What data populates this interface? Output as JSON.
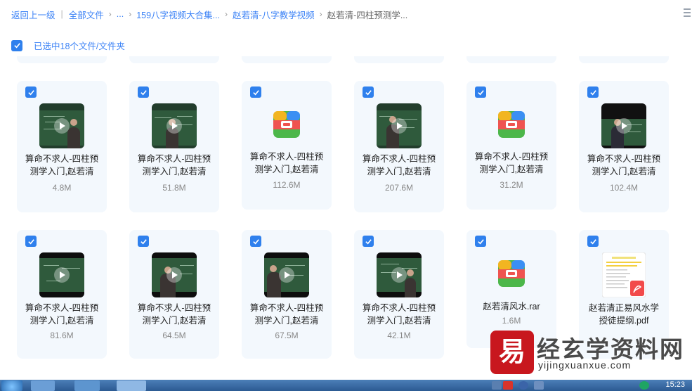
{
  "breadcrumb": {
    "back": "返回上一级",
    "all_files": "全部文件",
    "ellipsis": "...",
    "item1": "159八字视频大合集...",
    "item2": "赵若清-八字教学视频",
    "current": "赵若清-四柱预测学..."
  },
  "selection": {
    "text": "已选中18个文件/文件夹"
  },
  "files": [
    {
      "name_line1": "算命不求人-四柱预",
      "name_line2": "测学入门,赵若清",
      "size": "4.8M",
      "type": "video"
    },
    {
      "name_line1": "算命不求人-四柱预",
      "name_line2": "测学入门,赵若清",
      "size": "51.8M",
      "type": "video"
    },
    {
      "name_line1": "算命不求人-四柱预",
      "name_line2": "测学入门,赵若清",
      "size": "112.6M",
      "type": "rar"
    },
    {
      "name_line1": "算命不求人-四柱预",
      "name_line2": "测学入门,赵若清",
      "size": "207.6M",
      "type": "video"
    },
    {
      "name_line1": "算命不求人-四柱预",
      "name_line2": "测学入门,赵若清",
      "size": "31.2M",
      "type": "rar"
    },
    {
      "name_line1": "算命不求人-四柱预",
      "name_line2": "测学入门,赵若清",
      "size": "102.4M",
      "type": "video"
    },
    {
      "name_line1": "算命不求人-四柱预",
      "name_line2": "测学入门,赵若清",
      "size": "81.6M",
      "type": "video"
    },
    {
      "name_line1": "算命不求人-四柱预",
      "name_line2": "测学入门,赵若清",
      "size": "64.5M",
      "type": "video"
    },
    {
      "name_line1": "算命不求人-四柱预",
      "name_line2": "测学入门,赵若清",
      "size": "67.5M",
      "type": "video"
    },
    {
      "name_line1": "算命不求人-四柱预",
      "name_line2": "测学入门,赵若清",
      "size": "42.1M",
      "type": "video"
    },
    {
      "name_line1": "赵若清风水.rar",
      "name_line2": "",
      "size": "1.6M",
      "type": "rar"
    },
    {
      "name_line1": "赵若清正易风水学",
      "name_line2": "授徒提纲.pdf",
      "size": "",
      "type": "pdf"
    }
  ],
  "watermark": {
    "title": "经玄学资料网",
    "url": "yijingxuanxue.com"
  },
  "taskbar": {
    "time": "15:23"
  },
  "colors": {
    "accent": "#2f80ed",
    "card_bg": "#f3f8fd"
  }
}
